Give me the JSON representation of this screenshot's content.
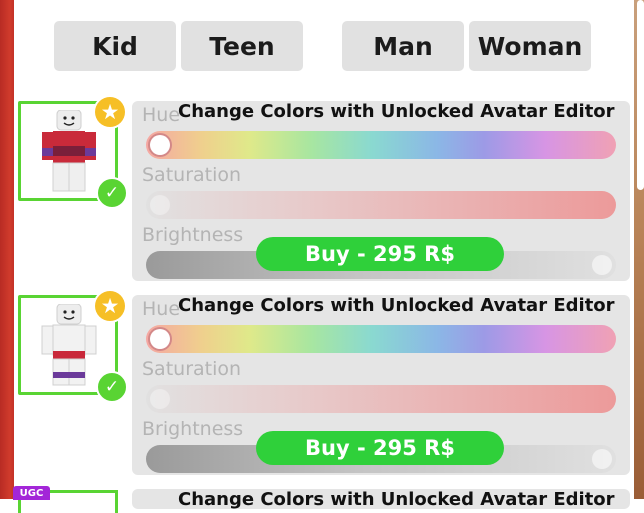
{
  "tabs": [
    "Kid",
    "Teen",
    "Man",
    "Woman"
  ],
  "items": [
    {
      "title": "Change Colors with Unlocked Avatar Editor",
      "hue_label": "Hue",
      "saturation_label": "Saturation",
      "brightness_label": "Brightness",
      "buy_label": "Buy - 295 R$",
      "hue_value": 0,
      "saturation_value": 0,
      "brightness_value": 1
    },
    {
      "title": "Change Colors with Unlocked Avatar Editor",
      "hue_label": "Hue",
      "saturation_label": "Saturation",
      "brightness_label": "Brightness",
      "buy_label": "Buy - 295 R$",
      "hue_value": 0,
      "saturation_value": 0,
      "brightness_value": 1
    },
    {
      "title": "Change Colors with Unlocked Avatar Editor",
      "badge": "UGC"
    }
  ],
  "colors": {
    "accent_green": "#2fd03a",
    "owned_green": "#59d433",
    "star_gold": "#f6bf26",
    "ugc_purple": "#a326d8"
  },
  "icons": {
    "favorite": "star-icon",
    "owned": "checkmark-icon"
  }
}
